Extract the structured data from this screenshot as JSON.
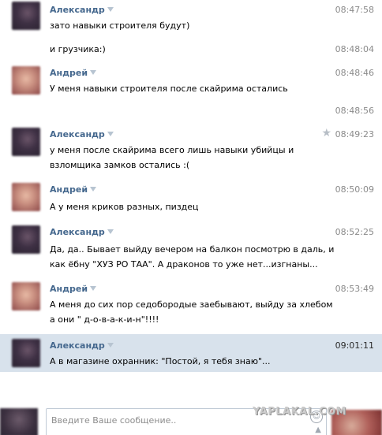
{
  "messages": [
    {
      "author": "Александр",
      "avatar": "alexander",
      "time": "08:47:58",
      "lines": [
        "зато навыки строителя будут)"
      ],
      "highlight": false,
      "star": false
    },
    {
      "author": "",
      "avatar": "",
      "time": "08:48:04",
      "lines": [
        "и грузчика:)"
      ],
      "highlight": false,
      "star": false
    },
    {
      "author": "Андрей",
      "avatar": "andrey",
      "time": "08:48:46",
      "lines": [
        "У меня навыки строителя после скайрима остались"
      ],
      "highlight": false,
      "star": false
    },
    {
      "author": "",
      "avatar": "",
      "time": "08:48:56",
      "lines": [],
      "highlight": false,
      "star": false
    },
    {
      "author": "Александр",
      "avatar": "alexander",
      "time": "08:49:23",
      "lines": [
        "у меня после скайрима всего лишь навыки убийцы и",
        "взломщика замков остались :("
      ],
      "highlight": false,
      "star": true
    },
    {
      "author": "Андрей",
      "avatar": "andrey",
      "time": "08:50:09",
      "lines": [
        "А у меня криков разных, пиздец"
      ],
      "highlight": false,
      "star": false
    },
    {
      "author": "Александр",
      "avatar": "alexander",
      "time": "08:52:25",
      "lines": [
        "Да, да.. Бывает выйду вечером на балкон посмотрю в даль, и",
        "как ёбну \"ХУЗ РО ТАА\". А драконов то уже нет...изгнаны..."
      ],
      "highlight": false,
      "star": false
    },
    {
      "author": "Андрей",
      "avatar": "andrey",
      "time": "08:53:49",
      "lines": [
        "А меня до сих пор седобородые заебывают, выйду за хлебом",
        "а они \" д-о-в-а-к-и-н\"!!!!"
      ],
      "highlight": false,
      "star": false
    },
    {
      "author": "Александр",
      "avatar": "alexander",
      "time": "09:01:11",
      "lines": [
        "А в магазине охранник: \"Постой, я тебя знаю\"..."
      ],
      "highlight": true,
      "star": false
    }
  ],
  "composer": {
    "placeholder": "Введите Ваше сообщение.."
  },
  "watermark": "YAPLAKAL.COM",
  "colors": {
    "author": "#45688e",
    "highlight": "#d8e2ec",
    "time": "#8a8a8a"
  }
}
